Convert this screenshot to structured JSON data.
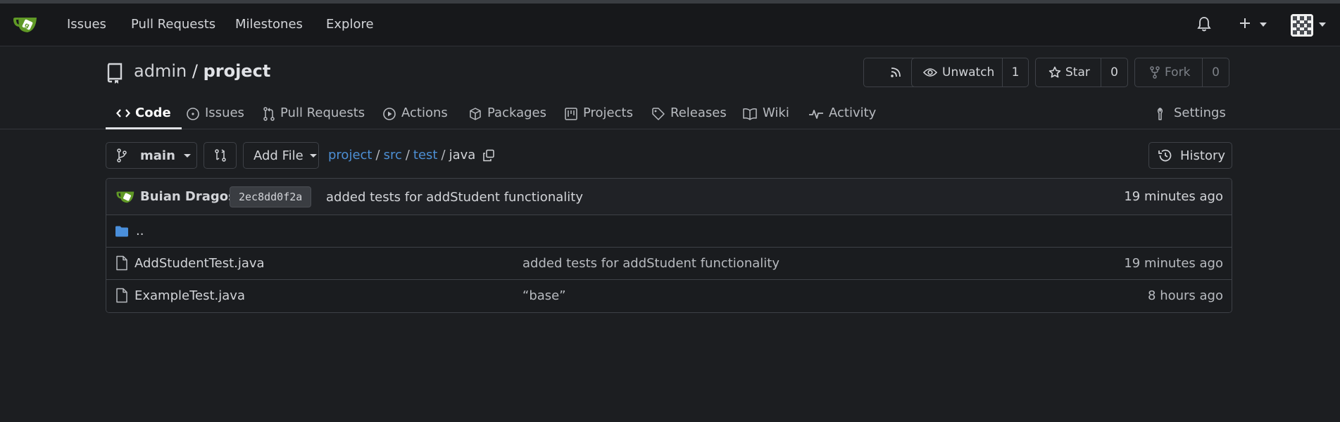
{
  "navbar": {
    "links": [
      "Issues",
      "Pull Requests",
      "Milestones",
      "Explore"
    ]
  },
  "repo": {
    "owner": "admin",
    "separator": "/",
    "name": "project",
    "unwatch_label": "Unwatch",
    "watch_count": "1",
    "star_label": "Star",
    "star_count": "0",
    "fork_label": "Fork",
    "fork_count": "0"
  },
  "tabs": [
    {
      "label": "Code",
      "icon": "code-icon",
      "active": true
    },
    {
      "label": "Issues",
      "icon": "issue-icon"
    },
    {
      "label": "Pull Requests",
      "icon": "pull-request-icon"
    },
    {
      "label": "Actions",
      "icon": "play-icon"
    },
    {
      "label": "Packages",
      "icon": "package-icon"
    },
    {
      "label": "Projects",
      "icon": "project-icon"
    },
    {
      "label": "Releases",
      "icon": "tag-icon"
    },
    {
      "label": "Wiki",
      "icon": "book-icon"
    },
    {
      "label": "Activity",
      "icon": "pulse-icon"
    },
    {
      "label": "Settings",
      "icon": "tool-icon"
    }
  ],
  "toolbar": {
    "branch": "main",
    "add_file": "Add File",
    "history": "History"
  },
  "breadcrumb": {
    "parts": [
      "project",
      "src",
      "test"
    ],
    "current": "java",
    "sep": "/"
  },
  "latest_commit": {
    "author": "Buian Dragos",
    "sha": "2ec8dd0f2a",
    "message": "added tests for addStudent functionality",
    "time": "19 minutes ago"
  },
  "files": {
    "parent": "..",
    "rows": [
      {
        "name": "AddStudentTest.java",
        "message": "added tests for addStudent functionality",
        "time": "19 minutes ago"
      },
      {
        "name": "ExampleTest.java",
        "message": "“base”",
        "time": "8 hours ago"
      }
    ]
  },
  "colors": {
    "accent_link": "#4d8fd4",
    "folder": "#4a8fdb",
    "logo_green": "#609926"
  }
}
